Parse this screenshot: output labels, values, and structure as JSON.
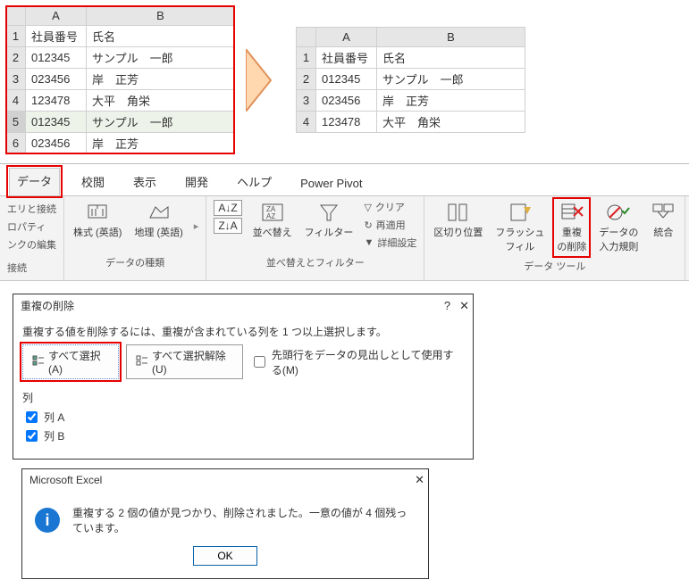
{
  "before_grid": {
    "cols": [
      "A",
      "B"
    ],
    "rows": [
      {
        "n": "1",
        "a": "社員番号",
        "b": "氏名"
      },
      {
        "n": "2",
        "a": "012345",
        "b": "サンプル　一郎"
      },
      {
        "n": "3",
        "a": "023456",
        "b": "岸　正芳"
      },
      {
        "n": "4",
        "a": "123478",
        "b": "大平　角栄"
      },
      {
        "n": "5",
        "a": "012345",
        "b": "サンプル　一郎"
      },
      {
        "n": "6",
        "a": "023456",
        "b": "岸　正芳"
      }
    ]
  },
  "after_grid": {
    "cols": [
      "A",
      "B"
    ],
    "rows": [
      {
        "n": "1",
        "a": "社員番号",
        "b": "氏名"
      },
      {
        "n": "2",
        "a": "012345",
        "b": "サンプル　一郎"
      },
      {
        "n": "3",
        "a": "023456",
        "b": "岸　正芳"
      },
      {
        "n": "4",
        "a": "123478",
        "b": "大平　角栄"
      }
    ]
  },
  "tabs": {
    "data": "データ",
    "review": "校閲",
    "view": "表示",
    "dev": "開発",
    "help": "ヘルプ",
    "powerpivot": "Power Pivot"
  },
  "sidecol": {
    "queries": "エリと接続",
    "props": "ロパティ",
    "links": "ンクの編集",
    "conn_group": "接続"
  },
  "ribbon": {
    "group_types": "データの種類",
    "stock": "株式 (英語)",
    "geo": "地理 (英語)",
    "sort": "並べ替え",
    "filter": "フィルター",
    "clear": "クリア",
    "reapply": "再適用",
    "advanced": "詳細設定",
    "group_sortfilter": "並べ替えとフィルター",
    "texttocol": "区切り位置",
    "flashfill": "フラッシュ\nフィル",
    "removedup": "重複\nの削除",
    "datavalid": "データの\n入力規則",
    "consolidate": "統合",
    "group_tools": "データ ツール"
  },
  "dlg1": {
    "title": "重複の削除",
    "desc": "重複する値を削除するには、重複が含まれている列を 1 つ以上選択します。",
    "select_all": "すべて選択(A)",
    "unselect_all": "すべて選択解除(U)",
    "use_header": "先頭行をデータの見出しとして使用する(M)",
    "cols_label": "列",
    "colA": "列 A",
    "colB": "列 B"
  },
  "dlg2": {
    "title": "Microsoft Excel",
    "msg": "重複する 2 個の値が見つかり、削除されました。一意の値が 4 個残っています。",
    "ok": "OK"
  }
}
